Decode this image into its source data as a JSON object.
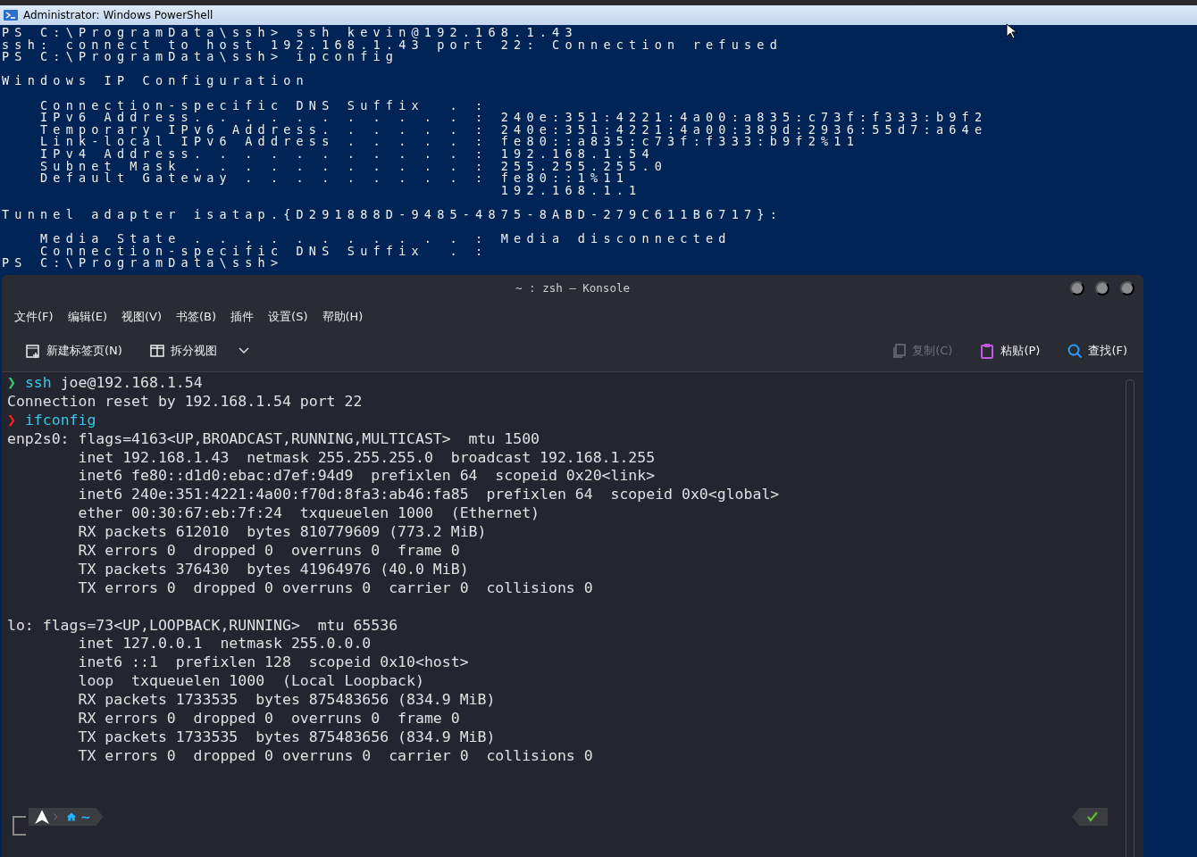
{
  "powershell": {
    "title": "Administrator: Windows PowerShell",
    "blocks": [
      [
        "PS C:\\ProgramData\\ssh> ssh kevin@192.168.1.43",
        "ssh: connect to host 192.168.1.43 port 22: Connection refused",
        "PS C:\\ProgramData\\ssh> ipconfig"
      ],
      [
        "Windows IP Configuration"
      ],
      [
        "   Connection-specific DNS Suffix  . :",
        "   IPv6 Address. . . . . . . . . . . : 240e:351:4221:4a00:a835:c73f:f333:b9f2",
        "   Temporary IPv6 Address. . . . . . : 240e:351:4221:4a00:389d:2936:55d7:a64e",
        "   Link-local IPv6 Address . . . . . : fe80::a835:c73f:f333:b9f2%11",
        "   IPv4 Address. . . . . . . . . . . : 192.168.1.54",
        "   Subnet Mask . . . . . . . . . . . : 255.255.255.0",
        "   Default Gateway . . . . . . . . . : fe80::1%11",
        "                                       192.168.1.1"
      ],
      [
        "Tunnel adapter isatap.{D291888D-9485-4875-8ABD-279C611B6717}:"
      ],
      [
        "   Media State . . . . . . . . . . . : Media disconnected",
        "   Connection-specific DNS Suffix  . :",
        "PS C:\\ProgramData\\ssh>"
      ]
    ]
  },
  "konsole": {
    "title": "~ : zsh — Konsole",
    "menu": [
      "文件(F)",
      "编辑(E)",
      "视图(V)",
      "书签(B)",
      "插件",
      "设置(S)",
      "帮助(H)"
    ],
    "toolbar_left": [
      {
        "kind": "newtab",
        "label": "新建标签页(N)",
        "disabled": false
      },
      {
        "kind": "split",
        "label": "拆分视图",
        "disabled": false
      }
    ],
    "toolbar_right": [
      {
        "kind": "copy",
        "label": "复制(C)",
        "disabled": true
      },
      {
        "kind": "paste",
        "label": "粘贴(P)",
        "disabled": false
      },
      {
        "kind": "find",
        "label": "查找(F)",
        "disabled": false
      }
    ],
    "blocks": [
      [
        {
          "kind": "prompt",
          "success": true,
          "symbol": "❯",
          "command": "ssh",
          "args": " joe@192.168.1.54"
        },
        {
          "kind": "output",
          "text": "Connection reset by 192.168.1.54 port 22"
        },
        {
          "kind": "prompt",
          "success": false,
          "symbol": "❯",
          "command": "ifconfig"
        },
        {
          "kind": "output",
          "text": "enp2s0: flags=4163<UP,BROADCAST,RUNNING,MULTICAST>  mtu 1500"
        },
        {
          "kind": "output",
          "text": "        inet 192.168.1.43  netmask 255.255.255.0  broadcast 192.168.1.255"
        },
        {
          "kind": "output",
          "text": "        inet6 fe80::d1d0:ebac:d7ef:94d9  prefixlen 64  scopeid 0x20<link>"
        },
        {
          "kind": "output",
          "text": "        inet6 240e:351:4221:4a00:f70d:8fa3:ab46:fa85  prefixlen 64  scopeid 0x0<global>"
        },
        {
          "kind": "output",
          "text": "        ether 00:30:67:eb:7f:24  txqueuelen 1000  (Ethernet)"
        },
        {
          "kind": "output",
          "text": "        RX packets 612010  bytes 810779609 (773.2 MiB)"
        },
        {
          "kind": "output",
          "text": "        RX errors 0  dropped 0  overruns 0  frame 0"
        },
        {
          "kind": "output",
          "text": "        TX packets 376430  bytes 41964976 (40.0 MiB)"
        },
        {
          "kind": "output",
          "text": "        TX errors 0  dropped 0 overruns 0  carrier 0  collisions 0"
        }
      ],
      [
        {
          "kind": "output",
          "text": "lo: flags=73<UP,LOOPBACK,RUNNING>  mtu 65536"
        },
        {
          "kind": "output",
          "text": "        inet 127.0.0.1  netmask 255.0.0.0"
        },
        {
          "kind": "output",
          "text": "        inet6 ::1  prefixlen 128  scopeid 0x10<host>"
        },
        {
          "kind": "output",
          "text": "        loop  txqueuelen 1000  (Local Loopback)"
        },
        {
          "kind": "output",
          "text": "        RX packets 1733535  bytes 875483656 (834.9 MiB)"
        },
        {
          "kind": "output",
          "text": "        RX errors 0  dropped 0  overruns 0  frame 0"
        },
        {
          "kind": "output",
          "text": "        TX packets 1733535  bytes 875483656 (834.9 MiB)"
        },
        {
          "kind": "output",
          "text": "        TX errors 0  dropped 0 overruns 0  carrier 0  collisions 0"
        }
      ]
    ],
    "prompt_bar": {
      "directory": "~",
      "status_ok": true
    }
  }
}
